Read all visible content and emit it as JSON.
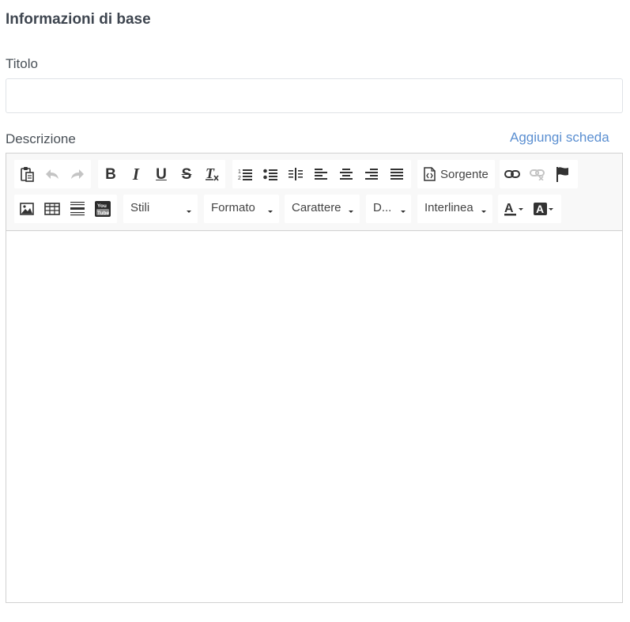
{
  "section": {
    "title": "Informazioni di base"
  },
  "fields": {
    "title_label": "Titolo",
    "title_value": "",
    "description_label": "Descrizione",
    "add_tab_link": "Aggiungi scheda"
  },
  "toolbar": {
    "source_label": "Sorgente",
    "combos": {
      "styles": "Stili",
      "format": "Formato",
      "font": "Carattere",
      "size": "D...",
      "line_height": "Interlinea"
    }
  },
  "colors": {
    "link": "#5b8fd1",
    "toolbar_bg": "#f8f8f8",
    "border": "#d1d1d1",
    "text": "#495057"
  }
}
